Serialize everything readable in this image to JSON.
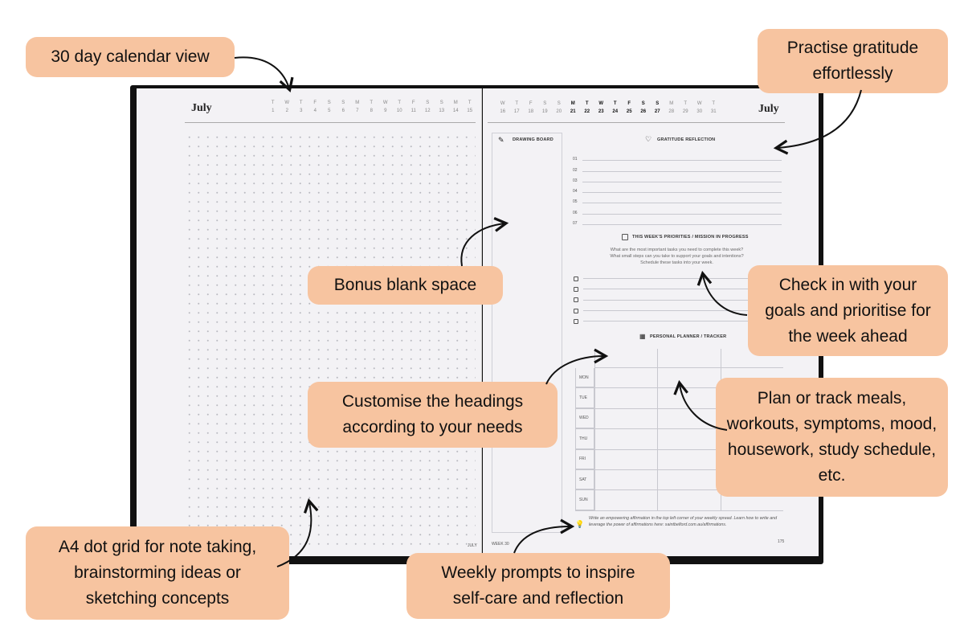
{
  "book": {
    "left_page": {
      "month": "July",
      "calendar": [
        [
          "T",
          "1"
        ],
        [
          "W",
          "2"
        ],
        [
          "T",
          "3"
        ],
        [
          "F",
          "4"
        ],
        [
          "S",
          "5"
        ],
        [
          "S",
          "6"
        ],
        [
          "M",
          "7"
        ],
        [
          "T",
          "8"
        ],
        [
          "W",
          "9"
        ],
        [
          "T",
          "10"
        ],
        [
          "F",
          "11"
        ],
        [
          "S",
          "12"
        ],
        [
          "S",
          "13"
        ],
        [
          "M",
          "14"
        ],
        [
          "T",
          "15"
        ]
      ],
      "footer": "JULY"
    },
    "right_page": {
      "month": "July",
      "calendar": [
        [
          "W",
          "16"
        ],
        [
          "T",
          "17"
        ],
        [
          "F",
          "18"
        ],
        [
          "S",
          "19"
        ],
        [
          "S",
          "20"
        ],
        [
          "M",
          "21",
          true
        ],
        [
          "T",
          "22",
          true
        ],
        [
          "W",
          "23",
          true
        ],
        [
          "T",
          "24",
          true
        ],
        [
          "F",
          "25",
          true
        ],
        [
          "S",
          "26",
          true
        ],
        [
          "S",
          "27",
          true
        ],
        [
          "M",
          "28"
        ],
        [
          "T",
          "29"
        ],
        [
          "W",
          "30"
        ],
        [
          "T",
          "31"
        ]
      ],
      "drawing_board": "DRAWING BOARD",
      "gratitude_heading": "GRATITUDE REFLECTION",
      "gratitude_numbers": [
        "01",
        "02",
        "03",
        "04",
        "05",
        "06",
        "07"
      ],
      "priorities_heading": "THIS WEEK'S PRIORITIES / MISSION IN PROGRESS",
      "priorities_text": [
        "What are the most important tasks you need to complete this week?",
        "What small steps can you take to support your goals and intentions?",
        "Schedule these tasks into your week."
      ],
      "planner_heading": "PERSONAL PLANNER / TRACKER",
      "days": [
        "MON",
        "TUE",
        "WED",
        "THU",
        "FRI",
        "SAT",
        "SUN"
      ],
      "prompt": "Write an empowering affirmation in the top left corner of your weekly spread. Learn how to write and leverage the power of affirmations here: saintbelford.com.au/affirmations.",
      "week": "WEEK 30",
      "page_number": "175"
    }
  },
  "callouts": {
    "calendar": "30 day calendar view",
    "gratitude": "Practise gratitude effortlessly",
    "blank": "Bonus blank space",
    "goals": "Check in with your goals and prioritise for the week ahead",
    "track": "Plan or track meals, workouts, symptoms, mood, housework, study schedule, etc.",
    "headings": "Customise the headings according to your needs",
    "dotgrid": "A4 dot grid for note taking, brainstorming ideas or sketching concepts",
    "prompts": "Weekly prompts to inspire self-care and reflection"
  },
  "colors": {
    "callout": "#f7c4a0",
    "cover": "#111111",
    "paper": "#f3f2f5"
  }
}
